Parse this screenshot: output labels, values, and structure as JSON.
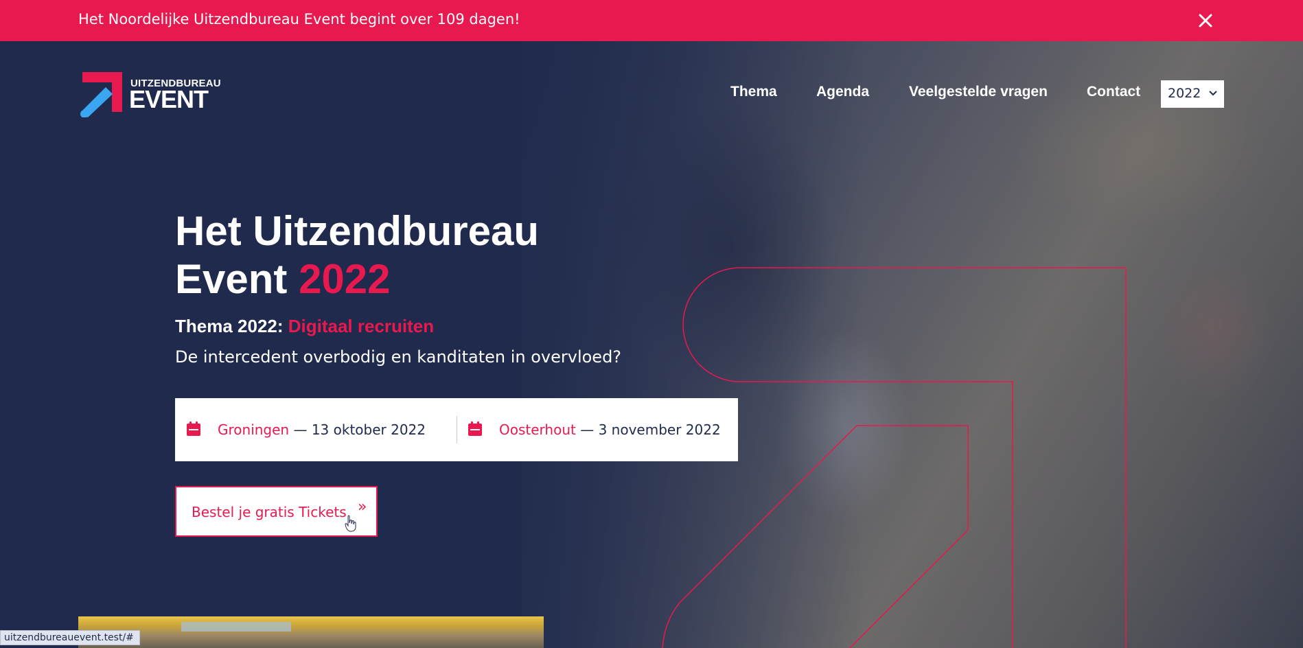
{
  "announcement": {
    "text": "Het Noordelijke Uitzendbureau Event begint over 109 dagen!",
    "close_icon": "close-icon"
  },
  "logo": {
    "top_text": "UITZENDBUREAU",
    "main_text": "EVENT"
  },
  "nav": {
    "items": [
      "Thema",
      "Agenda",
      "Veelgestelde vragen",
      "Contact"
    ],
    "year_select": "2022"
  },
  "hero": {
    "title_line1": "Het Uitzendbureau",
    "title_line2_prefix": "Event ",
    "title_year": "2022",
    "theme_prefix": "Thema 2022: ",
    "theme_value": "Digitaal recruiten",
    "subtitle": "De intercedent overbodig en kanditaten in overvloed?"
  },
  "dates": [
    {
      "city": "Groningen",
      "date": " — 13 oktober 2022",
      "icon": "calendar-icon"
    },
    {
      "city": "Oosterhout",
      "date": " — 3 november 2022",
      "icon": "calendar-icon"
    }
  ],
  "cta": {
    "label": "Bestel je gratis Tickets",
    "arrow": "»"
  },
  "status_bar": {
    "url": "uitzendbureauevent.test/#"
  },
  "colors": {
    "brand_pink": "#e8194f",
    "navy": "#1f2a4d",
    "logo_blue": "#3aa5f0"
  }
}
